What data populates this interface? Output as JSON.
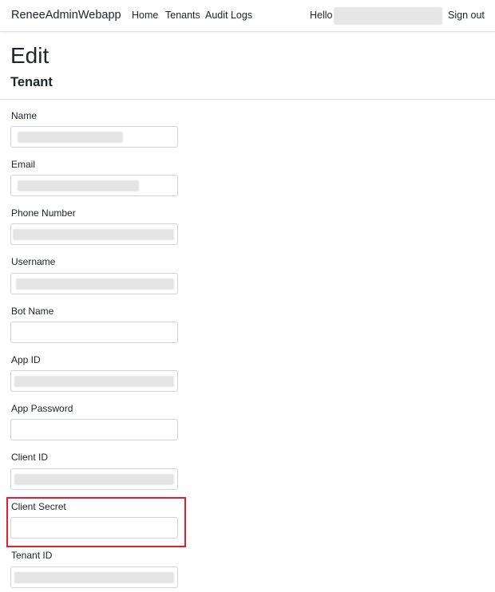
{
  "navbar": {
    "brand": "ReneeAdminWebapp",
    "links": [
      {
        "label": "Home"
      },
      {
        "label": "Tenants"
      },
      {
        "label": "Audit Logs"
      }
    ],
    "hello_label": "Hello",
    "signout_label": "Sign out"
  },
  "page": {
    "title": "Edit",
    "subtitle": "Tenant"
  },
  "form": {
    "fields": [
      {
        "label": "Name",
        "value": ""
      },
      {
        "label": "Email",
        "value": ""
      },
      {
        "label": "Phone Number",
        "value": ""
      },
      {
        "label": "Username",
        "value": ""
      },
      {
        "label": "Bot Name",
        "value": ""
      },
      {
        "label": "App ID",
        "value": ""
      },
      {
        "label": "App Password",
        "value": ""
      },
      {
        "label": "Client ID",
        "value": ""
      },
      {
        "label": "Client Secret",
        "value": ""
      },
      {
        "label": "Tenant ID",
        "value": ""
      }
    ]
  },
  "colors": {
    "highlight": "#e0202a",
    "border": "#ced4da",
    "text": "#212529"
  }
}
